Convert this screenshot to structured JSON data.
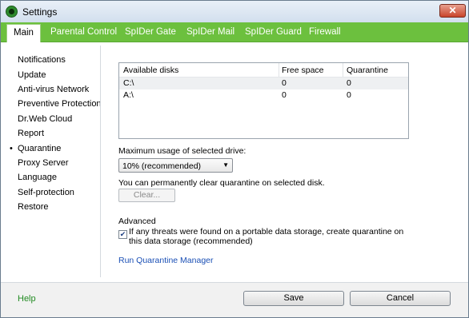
{
  "window": {
    "title": "Settings",
    "close_glyph": "✕"
  },
  "tabs": [
    {
      "label": "Main",
      "active": true
    },
    {
      "label": "Parental Control"
    },
    {
      "label": "SpIDer Gate"
    },
    {
      "label": "SpIDer Mail"
    },
    {
      "label": "SpIDer Guard"
    },
    {
      "label": "Firewall"
    }
  ],
  "sidebar": {
    "items": [
      {
        "label": "Notifications"
      },
      {
        "label": "Update"
      },
      {
        "label": "Anti-virus Network"
      },
      {
        "label": "Preventive Protection"
      },
      {
        "label": "Dr.Web Cloud"
      },
      {
        "label": "Report"
      },
      {
        "label": "Quarantine",
        "selected": true
      },
      {
        "label": "Proxy Server"
      },
      {
        "label": "Language"
      },
      {
        "label": "Self-protection"
      },
      {
        "label": "Restore"
      }
    ],
    "bullet": "•"
  },
  "disks_table": {
    "headers": [
      "Available disks",
      "Free space",
      "Quarantine"
    ],
    "rows": [
      {
        "disk": "C:\\",
        "free_space": "0",
        "quarantine": "0"
      },
      {
        "disk": "A:\\",
        "free_space": "0",
        "quarantine": "0"
      }
    ]
  },
  "max_usage": {
    "label": "Maximum usage of selected drive:",
    "selected_value": "10% (recommended)",
    "arrow": "▼"
  },
  "clear": {
    "info": "You can permanently clear quarantine on selected disk.",
    "button_label": "Clear..."
  },
  "advanced": {
    "heading": "Advanced",
    "checkbox_checked": true,
    "checkbox_mark": "✔",
    "checkbox_label": "If any threats were found on a portable data storage, create quarantine on this data storage (recommended)"
  },
  "quarantine_manager_link": "Run Quarantine Manager",
  "footer": {
    "help_label": "Help",
    "save_label": "Save",
    "cancel_label": "Cancel"
  },
  "colors": {
    "tab_bar": "#6cc03e",
    "link": "#1a4fb5",
    "help": "#228b22",
    "close_button": "#c9442a"
  }
}
